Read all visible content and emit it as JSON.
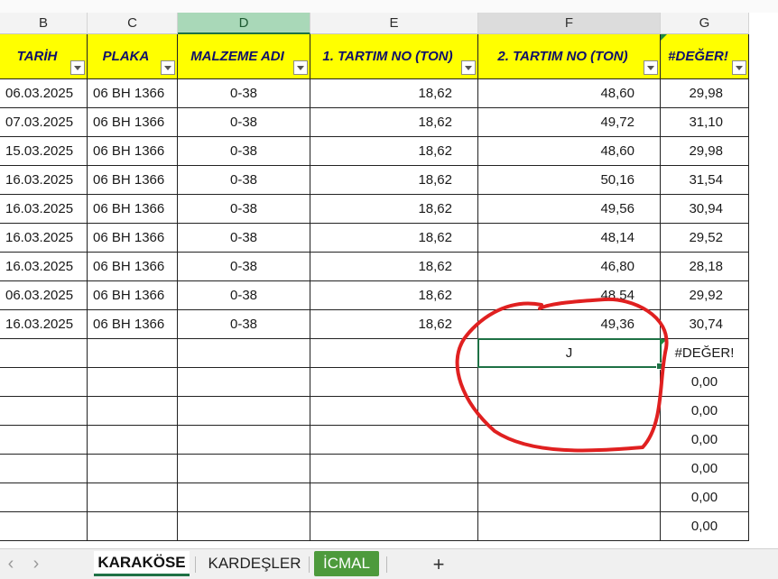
{
  "columns": [
    "B",
    "C",
    "D",
    "E",
    "F",
    "G"
  ],
  "headers": [
    "TARİH",
    "PLAKA",
    "MALZEME ADI",
    "1. TARTIM NO (TON)",
    "2. TARTIM NO (TON)",
    "#DEĞER!"
  ],
  "rows": [
    [
      "06.03.2025",
      "06 BH 1366",
      "0-38",
      "18,62",
      "48,60",
      "29,98"
    ],
    [
      "07.03.2025",
      "06 BH 1366",
      "0-38",
      "18,62",
      "49,72",
      "31,10"
    ],
    [
      "15.03.2025",
      "06 BH 1366",
      "0-38",
      "18,62",
      "48,60",
      "29,98"
    ],
    [
      "16.03.2025",
      "06 BH 1366",
      "0-38",
      "18,62",
      "50,16",
      "31,54"
    ],
    [
      "16.03.2025",
      "06 BH 1366",
      "0-38",
      "18,62",
      "49,56",
      "30,94"
    ],
    [
      "16.03.2025",
      "06 BH 1366",
      "0-38",
      "18,62",
      "48,14",
      "29,52"
    ],
    [
      "16.03.2025",
      "06 BH 1366",
      "0-38",
      "18,62",
      "46,80",
      "28,18"
    ],
    [
      "06.03.2025",
      "06 BH 1366",
      "0-38",
      "18,62",
      "48,54",
      "29,92"
    ],
    [
      "16.03.2025",
      "06 BH 1366",
      "0-38",
      "18,62",
      "49,36",
      "30,74"
    ],
    [
      "",
      "",
      "",
      "",
      "J",
      "#DEĞER!"
    ],
    [
      "",
      "",
      "",
      "",
      "",
      "0,00"
    ],
    [
      "",
      "",
      "",
      "",
      "",
      "0,00"
    ],
    [
      "",
      "",
      "",
      "",
      "",
      "0,00"
    ],
    [
      "",
      "",
      "",
      "",
      "",
      "0,00"
    ],
    [
      "",
      "",
      "",
      "",
      "",
      "0,00"
    ],
    [
      "",
      "",
      "",
      "",
      "",
      "0,00"
    ]
  ],
  "active_cell_value": "J",
  "sheet_tabs": [
    "KARAKÖSE",
    "KARDEŞLER",
    "İCMAL"
  ],
  "nav": {
    "prev": "‹",
    "next": "›",
    "add": "+"
  },
  "colors": {
    "header_fill": "#ffff00",
    "header_text": "#0f0f6a",
    "selection_green": "#1e7145",
    "tab_green": "#4d9a3c",
    "annotation_red": "#e02020"
  },
  "icons": [
    "filter-dropdown-icon",
    "chevron-left-icon",
    "chevron-right-icon",
    "plus-icon"
  ]
}
